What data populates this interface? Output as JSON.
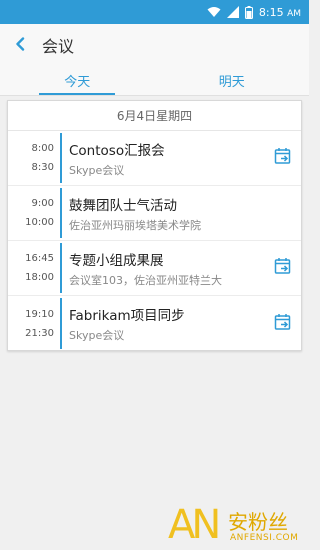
{
  "status_bar": {
    "time": "8:15",
    "time_suffix": "AM"
  },
  "header": {
    "title": "会议"
  },
  "tabs": [
    {
      "label": "今天",
      "active": true
    },
    {
      "label": "明天",
      "active": false
    }
  ],
  "date_header": "6月4日星期四",
  "events": [
    {
      "start": "8:00",
      "end": "8:30",
      "title": "Contoso汇报会",
      "location": "Skype会议",
      "has_join": true
    },
    {
      "start": "9:00",
      "end": "10:00",
      "title": "鼓舞团队士气活动",
      "location": "佐治亚州玛丽埃塔美术学院",
      "has_join": false
    },
    {
      "start": "16:45",
      "end": "18:00",
      "title": "专题小组成果展",
      "location": "会议室103，佐治亚州亚特兰大",
      "has_join": true
    },
    {
      "start": "19:10",
      "end": "21:30",
      "title": "Fabrikam项目同步",
      "location": "Skype会议",
      "has_join": true
    }
  ],
  "watermark": {
    "letters": "AN",
    "cn": "安粉丝",
    "en": "ANFENSI.COM"
  },
  "colors": {
    "accent": "#2f9bd6",
    "background": "#f0f0f0",
    "watermark": "#f0c020"
  }
}
